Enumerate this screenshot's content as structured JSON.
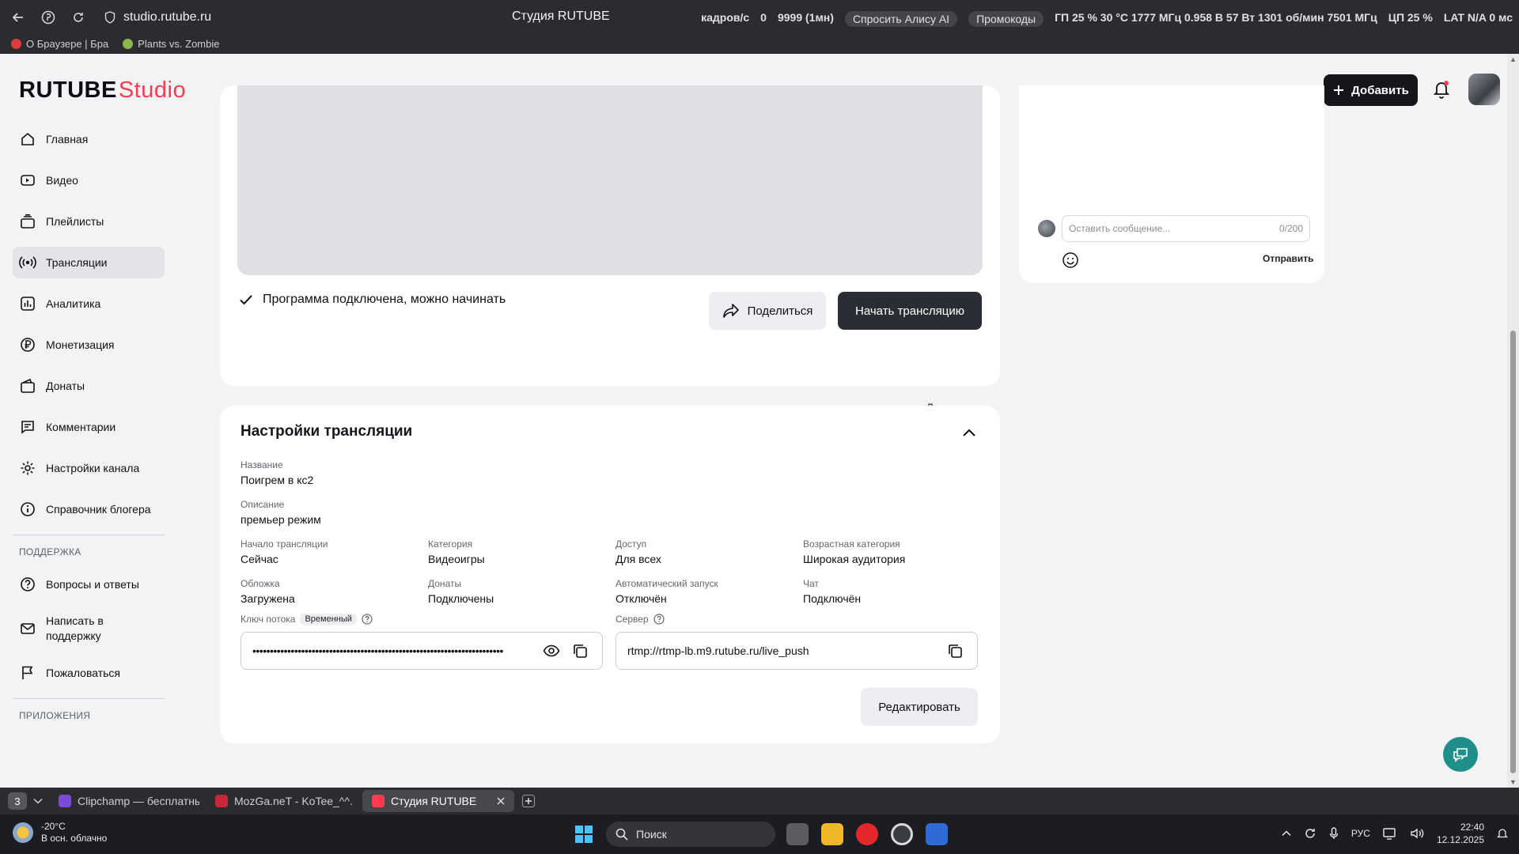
{
  "browser": {
    "url": "studio.rutube.ru",
    "tab_title": "Студия RUTUBE",
    "hud": {
      "fps_label": "кадров/с",
      "fps_value": "0",
      "h1": "9999 (1мн)",
      "alice": "Спросить Алису AI",
      "promo": "Промокоды",
      "gpu": "ГП 25 % 30 °C 1777 МГц 0.958 В 57 Вт 1301 об/мин 7501 МГц",
      "cpu": "ЦП 25 %",
      "lat": "LAT N/A 0 мс"
    },
    "bookmarks": [
      {
        "label": "О Браузере | Бра"
      },
      {
        "label": "Plants vs. Zombie"
      }
    ]
  },
  "header": {
    "logo_main": "RUTUBE",
    "logo_sub": "Studio",
    "add_label": "Добавить"
  },
  "sidebar": {
    "items": [
      {
        "label": "Главная"
      },
      {
        "label": "Видео"
      },
      {
        "label": "Плейлисты"
      },
      {
        "label": "Трансляции"
      },
      {
        "label": "Аналитика"
      },
      {
        "label": "Монетизация"
      },
      {
        "label": "Донаты"
      },
      {
        "label": "Комментарии"
      },
      {
        "label": "Настройки канала"
      },
      {
        "label": "Справочник блогера"
      }
    ],
    "support_heading": "ПОДДЕРЖКА",
    "support_items": [
      {
        "label": "Вопросы и ответы"
      },
      {
        "label": "Написать в поддержку"
      },
      {
        "label": "Пожаловаться"
      }
    ],
    "apps_heading": "ПРИЛОЖЕНИЯ"
  },
  "preview": {
    "status": "Программа подключена, можно начинать",
    "share_label": "Поделиться",
    "start_label": "Начать трансляцию"
  },
  "settings": {
    "title": "Настройки трансляции",
    "name_label": "Название",
    "name_value": "Поигрем в кс2",
    "desc_label": "Описание",
    "desc_value": "премьер режим",
    "grid": [
      {
        "label": "Начало трансляции",
        "value": "Сейчас"
      },
      {
        "label": "Категория",
        "value": "Видеоигры"
      },
      {
        "label": "Доступ",
        "value": "Для всех"
      },
      {
        "label": "Возрастная категория",
        "value": "Широкая аудитория"
      },
      {
        "label": "Обложка",
        "value": "Загружена"
      },
      {
        "label": "Донаты",
        "value": "Подключены"
      },
      {
        "label": "Автоматический запуск",
        "value": "Отключён"
      },
      {
        "label": "Чат",
        "value": "Подключён"
      }
    ],
    "key_label": "Ключ потока",
    "key_tag": "Временный",
    "key_value": "••••••••••••••••••••••••••••••••••••••••••••••••••••••••••••••••••••••••",
    "server_label": "Сервер",
    "server_value": "rtmp://rtmp-lb.m9.rutube.ru/live_push",
    "edit_label": "Редактировать"
  },
  "chat": {
    "placeholder": "Оставить сообщение...",
    "counter": "0/200",
    "send_label": "Отправить"
  },
  "tabs": {
    "count": "3",
    "items": [
      {
        "label": "Clipchamp — бесплатный",
        "color": "#7a4bd6"
      },
      {
        "label": "MozGa.neT - KoTee_^^. Cr",
        "color": "#c8283a"
      },
      {
        "label": "Студия RUTUBE",
        "color": "#ff3b4f"
      }
    ]
  },
  "taskbar": {
    "temp": "-20°C",
    "weather": "В осн. облачно",
    "search": "Поиск",
    "lang": "РУС",
    "time": "22:40",
    "date": "12.12.2025"
  },
  "colors": {
    "brand_red": "#ff3b4f",
    "dark_button": "#14161c",
    "page_bg": "#f2f3f5"
  }
}
